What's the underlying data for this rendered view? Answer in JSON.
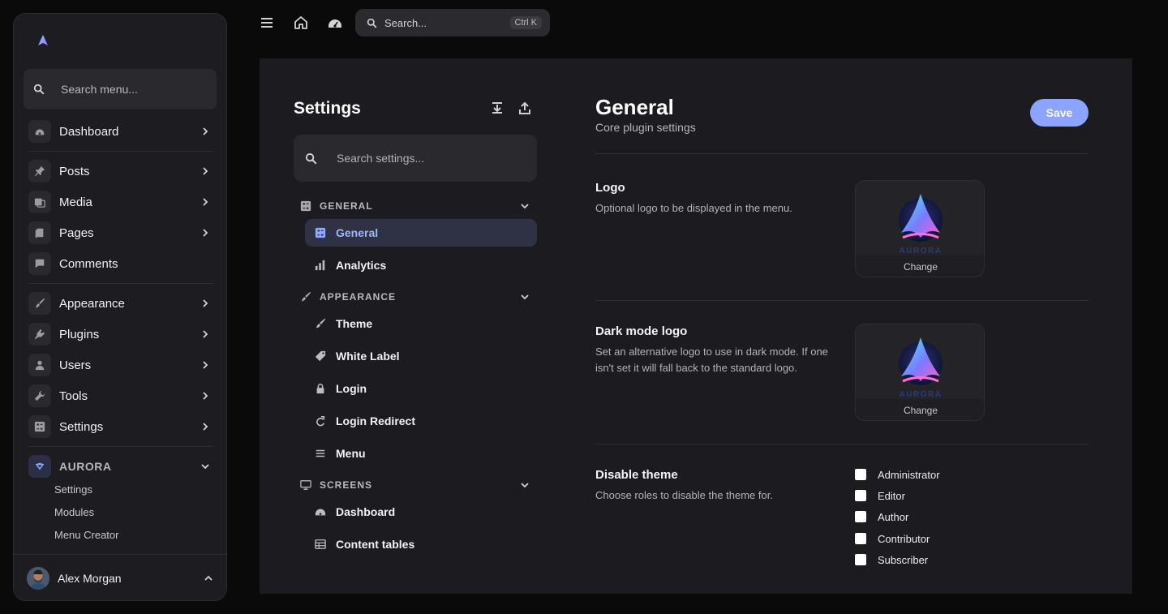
{
  "sidebar": {
    "search_placeholder": "Search menu...",
    "items": [
      {
        "label": "Dashboard",
        "icon": "dashboard-icon",
        "has_chevron": true
      },
      {
        "label": "Posts",
        "icon": "pin-icon",
        "has_chevron": true
      },
      {
        "label": "Media",
        "icon": "media-icon",
        "has_chevron": true
      },
      {
        "label": "Pages",
        "icon": "pages-icon",
        "has_chevron": true
      },
      {
        "label": "Comments",
        "icon": "comment-icon",
        "has_chevron": false
      },
      {
        "label": "Appearance",
        "icon": "brush-icon",
        "has_chevron": true
      },
      {
        "label": "Plugins",
        "icon": "plugin-icon",
        "has_chevron": true
      },
      {
        "label": "Users",
        "icon": "user-icon",
        "has_chevron": true
      },
      {
        "label": "Tools",
        "icon": "wrench-icon",
        "has_chevron": true
      },
      {
        "label": "Settings",
        "icon": "settings-icon",
        "has_chevron": true
      }
    ],
    "aurora": {
      "label": "AURORA",
      "sub_items": [
        "Settings",
        "Modules",
        "Menu Creator"
      ]
    },
    "user": {
      "name": "Alex Morgan"
    }
  },
  "topbar": {
    "search_placeholder": "Search...",
    "shortcut": "Ctrl K"
  },
  "settings_nav": {
    "title": "Settings",
    "search_placeholder": "Search settings...",
    "groups": [
      {
        "label": "GENERAL",
        "items": [
          {
            "label": "General",
            "active": true
          },
          {
            "label": "Analytics"
          }
        ]
      },
      {
        "label": "APPEARANCE",
        "items": [
          {
            "label": "Theme"
          },
          {
            "label": "White Label"
          },
          {
            "label": "Login"
          },
          {
            "label": "Login Redirect"
          },
          {
            "label": "Menu"
          }
        ]
      },
      {
        "label": "SCREENS",
        "items": [
          {
            "label": "Dashboard"
          },
          {
            "label": "Content tables"
          }
        ]
      }
    ]
  },
  "content": {
    "title": "General",
    "subtitle": "Core plugin settings",
    "save_label": "Save",
    "fields": [
      {
        "label": "Logo",
        "description": "Optional logo to be displayed in the menu.",
        "change_label": "Change"
      },
      {
        "label": "Dark mode logo",
        "description": "Set an alternative logo to use in dark mode. If one isn't set it will fall back to the standard logo.",
        "change_label": "Change"
      },
      {
        "label": "Disable theme",
        "description": "Choose roles to disable the theme for.",
        "roles": [
          "Administrator",
          "Editor",
          "Author",
          "Contributor",
          "Subscriber"
        ]
      }
    ]
  },
  "colors": {
    "accent": "#8ca3ff",
    "active_nav_bg": "#2f3245",
    "panel_bg": "#1c1c20",
    "page_bg": "#0a0a0b"
  }
}
